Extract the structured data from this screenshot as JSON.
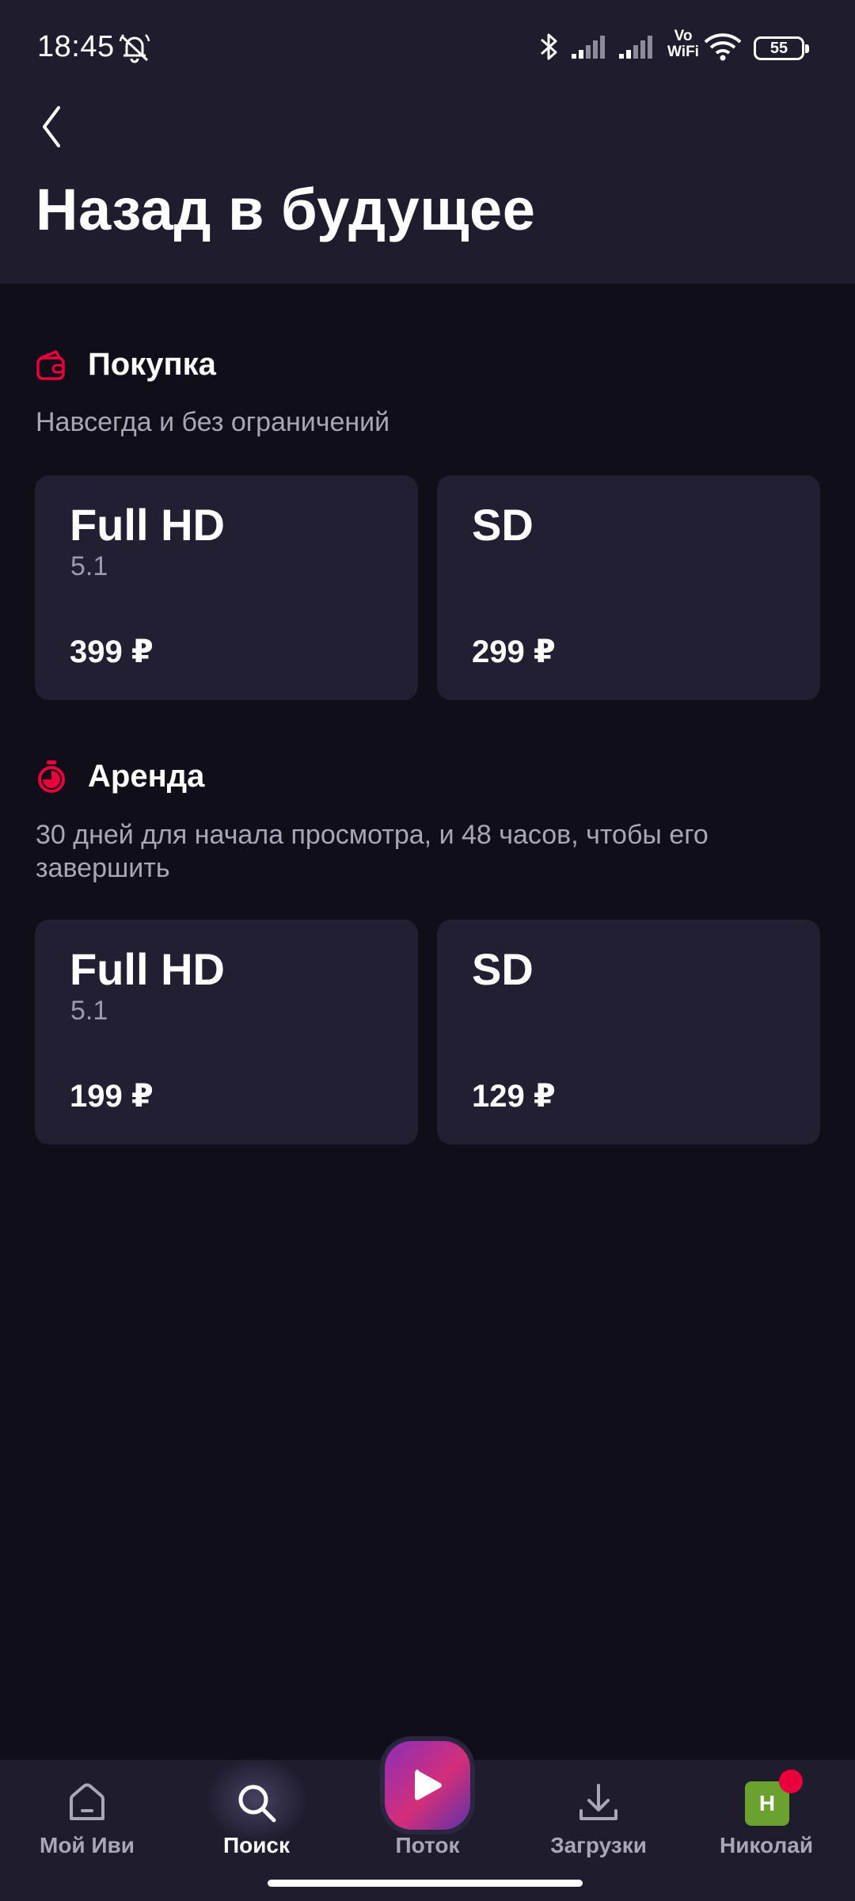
{
  "status_bar": {
    "time": "18:45",
    "battery": "55",
    "icons": [
      "alarm-off-icon",
      "bluetooth-icon",
      "signal-icon",
      "signal-icon",
      "vowifi-icon",
      "wifi-icon",
      "battery-icon"
    ],
    "vowifi_top": "Vo",
    "vowifi_bottom": "WiFi"
  },
  "header": {
    "back_icon": "chevron-left-icon",
    "title": "Назад в будущее"
  },
  "purchase": {
    "icon": "wallet-icon",
    "title": "Покупка",
    "description": "Навсегда и без ограничений",
    "options": [
      {
        "quality": "Full HD",
        "audio": "5.1",
        "price": "399 ₽"
      },
      {
        "quality": "SD",
        "audio": "",
        "price": "299 ₽"
      }
    ]
  },
  "rent": {
    "icon": "timer-icon",
    "title": "Аренда",
    "description": "30 дней для начала просмотра, и 48 часов, чтобы его завершить",
    "options": [
      {
        "quality": "Full HD",
        "audio": "5.1",
        "price": "199 ₽"
      },
      {
        "quality": "SD",
        "audio": "",
        "price": "129 ₽"
      }
    ]
  },
  "bottom_nav": {
    "items": [
      {
        "label": "Мой Иви",
        "icon": "home-icon",
        "active": false
      },
      {
        "label": "Поиск",
        "icon": "search-icon",
        "active": true
      },
      {
        "label": "Поток",
        "icon": "play-icon",
        "active": false
      },
      {
        "label": "Загрузки",
        "icon": "download-icon",
        "active": false
      },
      {
        "label": "Николай",
        "icon": "avatar",
        "active": false
      }
    ],
    "avatar_letter": "Н"
  },
  "colors": {
    "background": "#100e19",
    "header_bg": "#1f1c2e",
    "card_bg": "#221f33",
    "accent": "#ea003d",
    "muted_text": "#a9a6b6"
  }
}
